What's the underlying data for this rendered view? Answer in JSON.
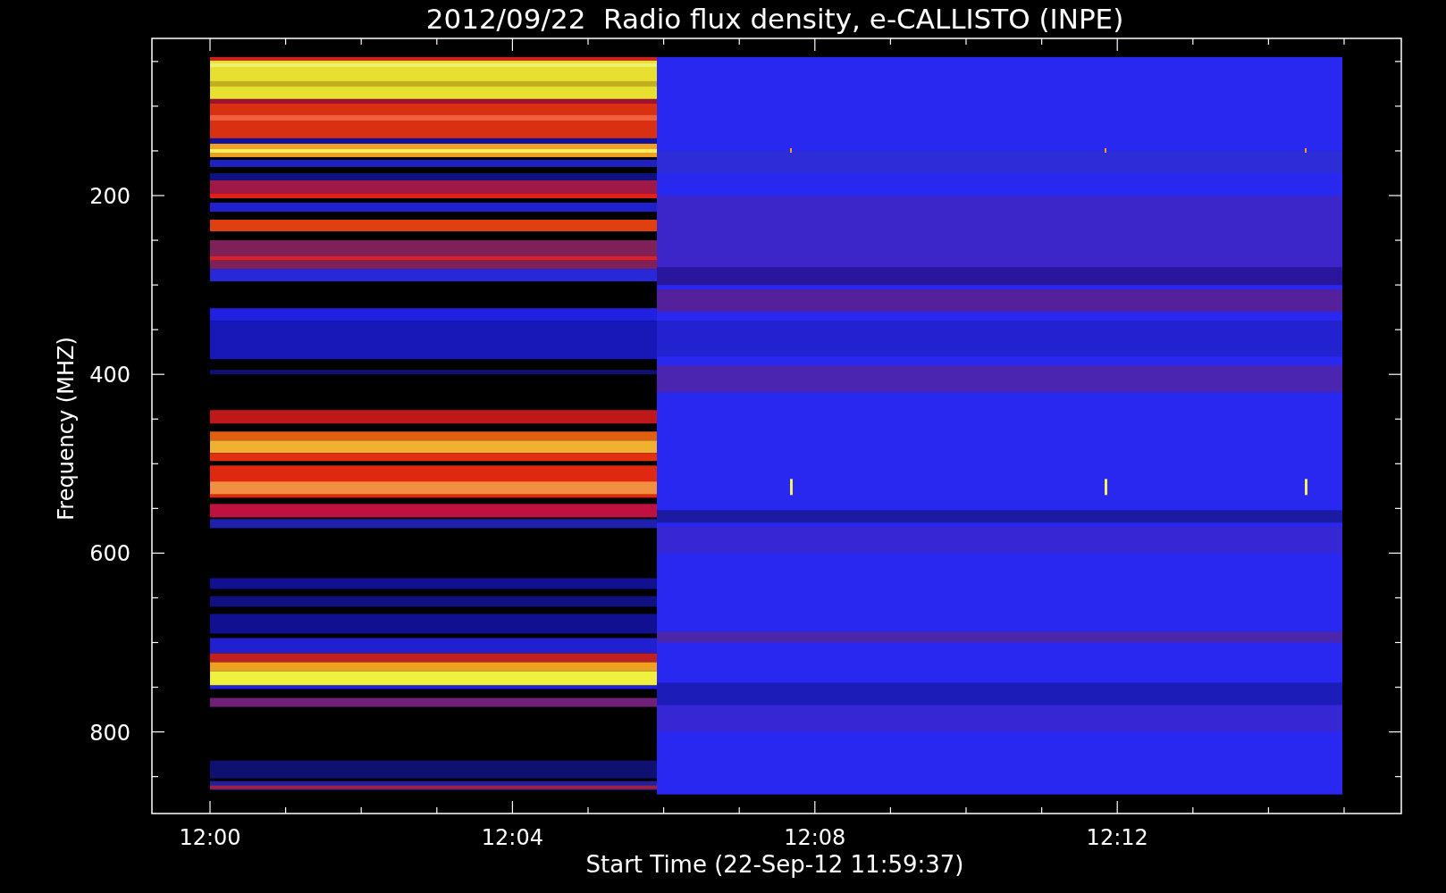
{
  "title": "2012/09/22  Radio flux density, e-CALLISTO (INPE)",
  "y_axis": {
    "label": "Frequency (MHZ)",
    "ticks": [
      "200",
      "400",
      "600",
      "800"
    ]
  },
  "x_axis": {
    "label": "Start Time (22-Sep-12 11:59:37)",
    "ticks": [
      "12:00",
      "12:04",
      "12:08",
      "12:12"
    ]
  }
}
